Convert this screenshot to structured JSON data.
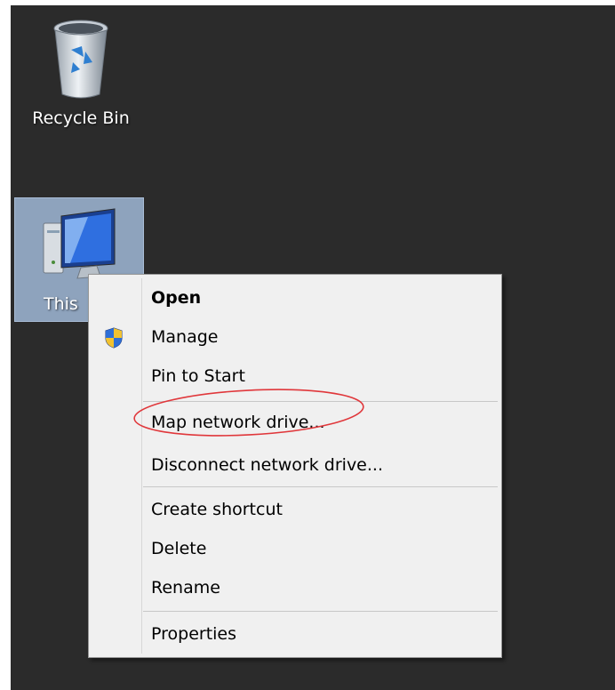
{
  "desktop": {
    "icons": [
      {
        "label": "Recycle Bin",
        "icon": "recycle-bin-icon"
      },
      {
        "label": "This",
        "icon": "computer-icon"
      }
    ]
  },
  "context_menu": {
    "items": [
      {
        "label": "Open",
        "bold": true
      },
      {
        "label": "Manage",
        "icon": "uac-shield-icon"
      },
      {
        "label": "Pin to Start"
      },
      {
        "label": "Map network drive...",
        "highlighted": true
      },
      {
        "label": "Disconnect network drive..."
      },
      {
        "label": "Create shortcut"
      },
      {
        "label": "Delete"
      },
      {
        "label": "Rename"
      },
      {
        "label": "Properties"
      }
    ]
  },
  "colors": {
    "desktop_bg": "#2b2b2b",
    "menu_bg": "#f0f0f0",
    "selection_bg": "#8ea3bd",
    "annotation": "#e0373b"
  }
}
